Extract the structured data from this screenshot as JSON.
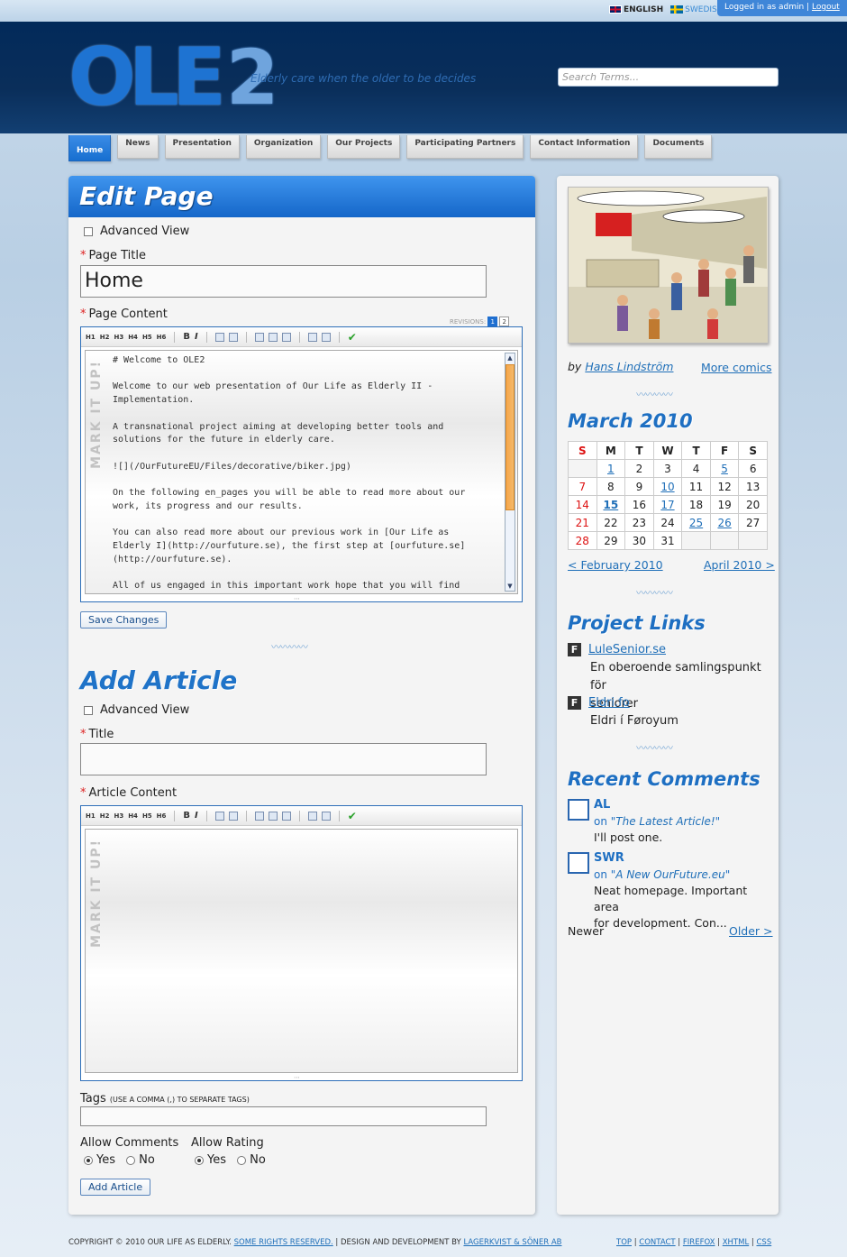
{
  "lang": {
    "english": "ENGLISH",
    "swedish": "SWEDISH"
  },
  "login": {
    "text": "Logged in as admin |",
    "logout": "Logout"
  },
  "header": {
    "logo_a": "OLE",
    "logo_b": "2",
    "tagline": "Elderly care when the older to be decides",
    "search_placeholder": "Search Terms..."
  },
  "nav": [
    "Home",
    "News",
    "Presentation",
    "Organization",
    "Our Projects",
    "Participating Partners",
    "Contact Information",
    "Documents"
  ],
  "edit": {
    "heading": "Edit Page",
    "advanced": "Advanced View",
    "title_label": "Page Title",
    "title_value": "Home",
    "content_label": "Page Content",
    "revisions_label": "REVISIONS:",
    "rev1": "1",
    "rev2": "2",
    "content": "# Welcome to OLE2\n\nWelcome to our web presentation of Our Life as Elderly II -\nImplementation.\n\nA transnational project aiming at developing better tools and\nsolutions for the future in elderly care.\n\n![](/OurFutureEU/Files/decorative/biker.jpg)\n\nOn the following en_pages you will be able to read more about our\nwork, its progress and our results.\n\nYou can also read more about our previous work in [Our Life as\nElderly I](http://ourfuture.se), the first step at [ourfuture.se]\n(http://ourfuture.se).\n\nAll of us engaged in this important work hope that you will find",
    "save": "Save Changes"
  },
  "toolbar": [
    "H1",
    "H2",
    "H3",
    "H4",
    "H5",
    "H6",
    "B",
    "I"
  ],
  "markitup": "MARK IT UP!",
  "article": {
    "heading": "Add Article",
    "advanced": "Advanced View",
    "title_label": "Title",
    "content_label": "Article Content",
    "tags_label": "Tags",
    "tags_hint": "(USE A COMMA (,) TO SEPARATE TAGS)",
    "comments_label": "Allow Comments",
    "rating_label": "Allow Rating",
    "yes": "Yes",
    "no": "No",
    "submit": "Add Article"
  },
  "sidebar": {
    "comic_by": "by",
    "comic_author": "Hans Lindström",
    "more_comics": "More comics",
    "cal_title": "March 2010",
    "cal_days": [
      "S",
      "M",
      "T",
      "W",
      "T",
      "F",
      "S"
    ],
    "cal_rows": [
      [
        "",
        "1",
        "2",
        "3",
        "4",
        "5",
        "6"
      ],
      [
        "7",
        "8",
        "9",
        "10",
        "11",
        "12",
        "13"
      ],
      [
        "14",
        "15",
        "16",
        "17",
        "18",
        "19",
        "20"
      ],
      [
        "21",
        "22",
        "23",
        "24",
        "25",
        "26",
        "27"
      ],
      [
        "28",
        "29",
        "30",
        "31",
        "",
        "",
        ""
      ]
    ],
    "cal_links": [
      "1",
      "5",
      "10",
      "15",
      "17",
      "25",
      "26"
    ],
    "prev_month": "< February 2010",
    "next_month": "April 2010 >",
    "links_title": "Project Links",
    "links": [
      {
        "name": "LuleSenior.se",
        "desc1": "En oberoende samlingspunkt för",
        "desc2": "seniorer"
      },
      {
        "name": "Eldri.fo",
        "desc1": "Eldri í Føroyum",
        "desc2": ""
      }
    ],
    "comments_title": "Recent Comments",
    "comments": [
      {
        "name": "AL",
        "on": "on",
        "article": "The Latest Article!",
        "text1": "I'll post one.",
        "text2": ""
      },
      {
        "name": "SWR",
        "on": "on",
        "article": "A New OurFuture.eu",
        "text1": "Neat homepage. Important area",
        "text2": "for development. Con..."
      }
    ],
    "newer": "Newer",
    "older": "Older >"
  },
  "footer": {
    "copy": "COPYRIGHT © 2010 OUR LIFE AS ELDERLY.",
    "rights": "SOME RIGHTS RESERVED.",
    "design": "| DESIGN AND DEVELOPMENT BY",
    "company": "LAGERKVIST & SÖNER AB",
    "links": [
      "TOP",
      "CONTACT",
      "FIREFOX",
      "XHTML",
      "CSS"
    ]
  }
}
